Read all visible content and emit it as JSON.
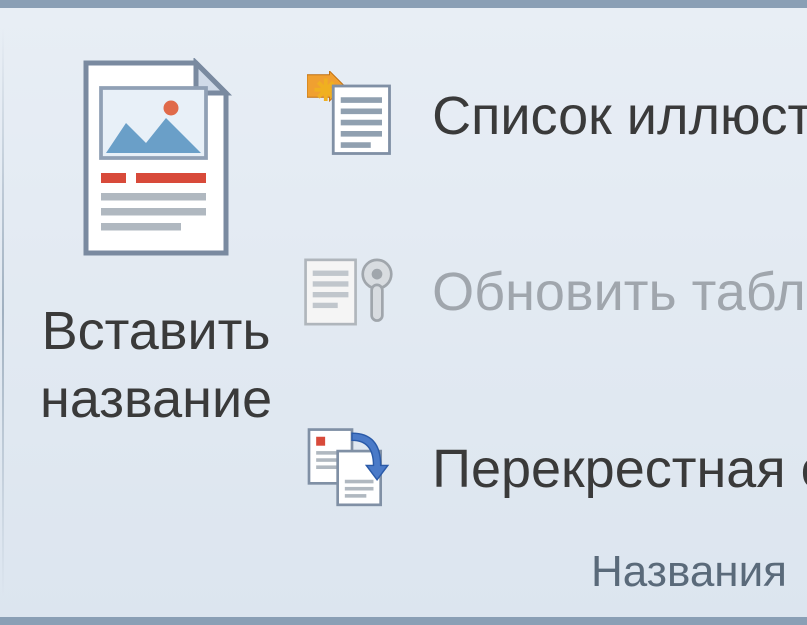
{
  "ribbon": {
    "group_name": "Названия",
    "insert_caption": {
      "label_line1": "Вставить",
      "label_line2": "название"
    },
    "items": [
      {
        "label": "Список иллюстраций",
        "enabled": true,
        "icon": "list-figures"
      },
      {
        "label": "Обновить таблицу",
        "enabled": false,
        "icon": "update-table"
      },
      {
        "label": "Перекрестная ссылка",
        "enabled": true,
        "icon": "cross-reference"
      }
    ]
  }
}
